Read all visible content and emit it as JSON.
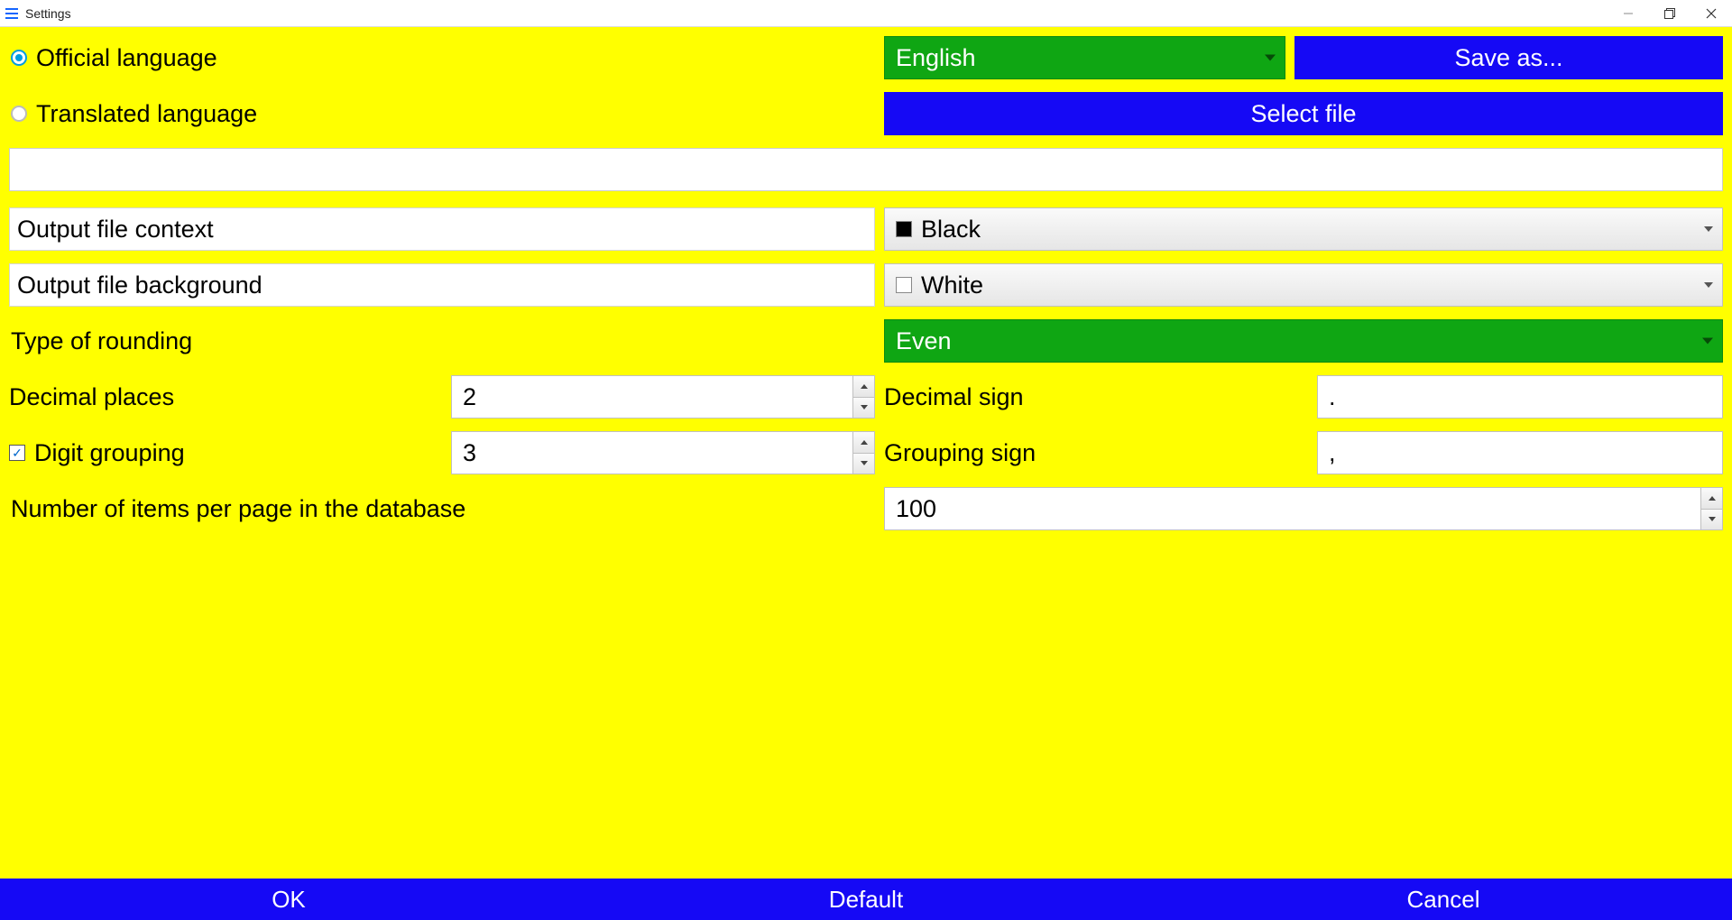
{
  "window": {
    "title": "Settings"
  },
  "language": {
    "official_label": "Official language",
    "translated_label": "Translated language",
    "selected": "English",
    "save_as_label": "Save as...",
    "select_file_label": "Select file",
    "file_path": ""
  },
  "output": {
    "context_label": "Output file context",
    "context_value": "Black",
    "background_label": "Output file background",
    "background_value": "White"
  },
  "rounding": {
    "label": "Type of rounding",
    "value": "Even"
  },
  "decimal_places": {
    "label": "Decimal places",
    "value": "2"
  },
  "decimal_sign": {
    "label": "Decimal sign",
    "value": "."
  },
  "digit_grouping": {
    "label": "Digit grouping",
    "value": "3",
    "checked": true
  },
  "grouping_sign": {
    "label": "Grouping sign",
    "value": ","
  },
  "items_per_page": {
    "label": "Number of items per page in the database",
    "value": "100"
  },
  "footer": {
    "ok": "OK",
    "default": "Default",
    "cancel": "Cancel"
  }
}
